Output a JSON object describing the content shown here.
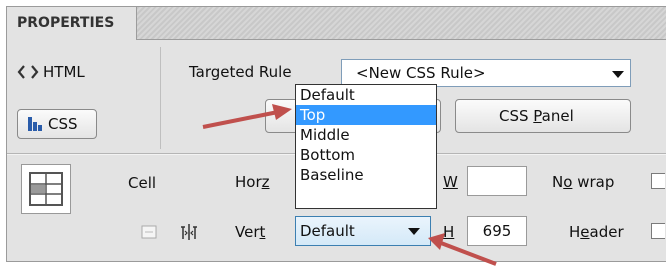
{
  "panel": {
    "tab_label": "PROPERTIES",
    "html_button": "HTML",
    "css_button": "CSS",
    "targeted_rule_label": "Targeted Rule",
    "targeted_rule_value": "<New CSS Rule>",
    "css_panel_button": "CSS Panel",
    "css_panel_mnemonic_pre": "CSS ",
    "css_panel_mnemonic_char": "P",
    "css_panel_mnemonic_post": "anel"
  },
  "cell": {
    "label": "Cell",
    "horz_pre": "Hor",
    "horz_ul": "z",
    "vert_pre": "Ver",
    "vert_ul": "t",
    "vert_value": "Default",
    "w_label": "W",
    "w_value": "",
    "h_label": "H",
    "h_value": "695",
    "nowrap_pre": "N",
    "nowrap_ul": "o",
    "nowrap_post": " wrap",
    "header_pre": "H",
    "header_ul": "e",
    "header_post": "ader"
  },
  "dropdown": {
    "options": [
      "Default",
      "Top",
      "Middle",
      "Bottom",
      "Baseline"
    ],
    "selected_index": 1
  },
  "colors": {
    "highlight": "#3399ff",
    "annotation_arrow": "#c0504d"
  },
  "icons": {
    "html_icon": "code-brackets-icon",
    "css_icon": "css-icon",
    "cell_icon": "table-cell-icon",
    "merge_icon": "merge-cells-icon",
    "split_icon": "split-cell-icon",
    "annotation": "red-arrow-icon"
  }
}
